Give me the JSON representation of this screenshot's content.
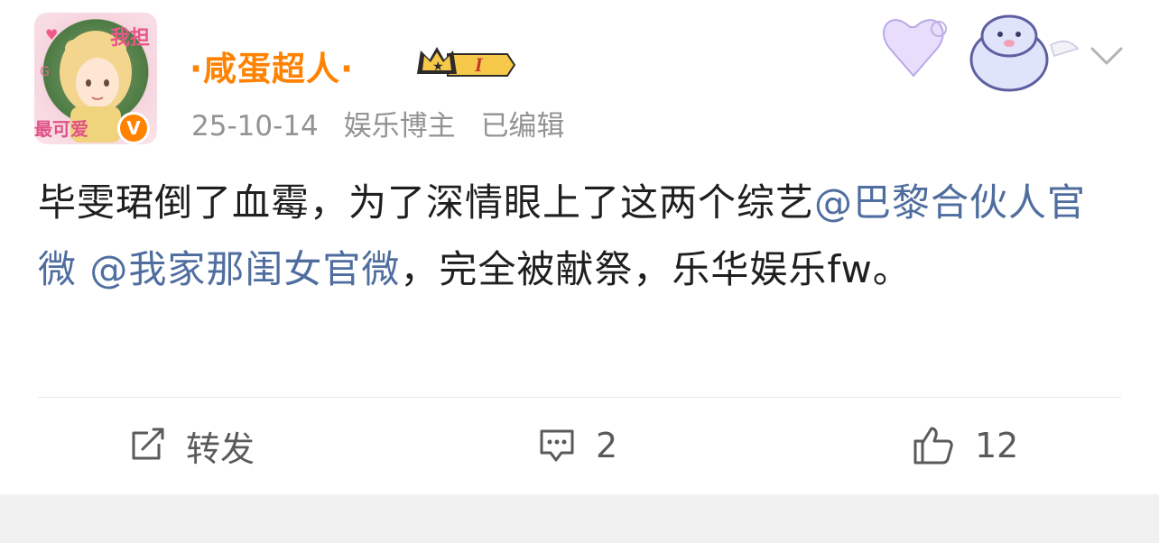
{
  "post": {
    "avatar": {
      "top_text": "我担",
      "bottom_text": "最可爱"
    },
    "username": "·咸蛋超人·",
    "vip_level": "I",
    "date": "25-10-14",
    "role": "娱乐博主",
    "edited": "已编辑",
    "content": {
      "text1": "毕雯珺倒了血霉，为了深情眼上了这两个综艺",
      "mention1": "@巴黎合伙人官微",
      "mention2": "@我家那闺女官微",
      "text2": "，完全被献祭，乐华娱乐fw。"
    },
    "actions": {
      "repost_label": "转发",
      "comment_count": "2",
      "like_count": "12"
    }
  },
  "colors": {
    "username": "#ff8200",
    "mention": "#4f6e9f",
    "meta": "#939393"
  }
}
